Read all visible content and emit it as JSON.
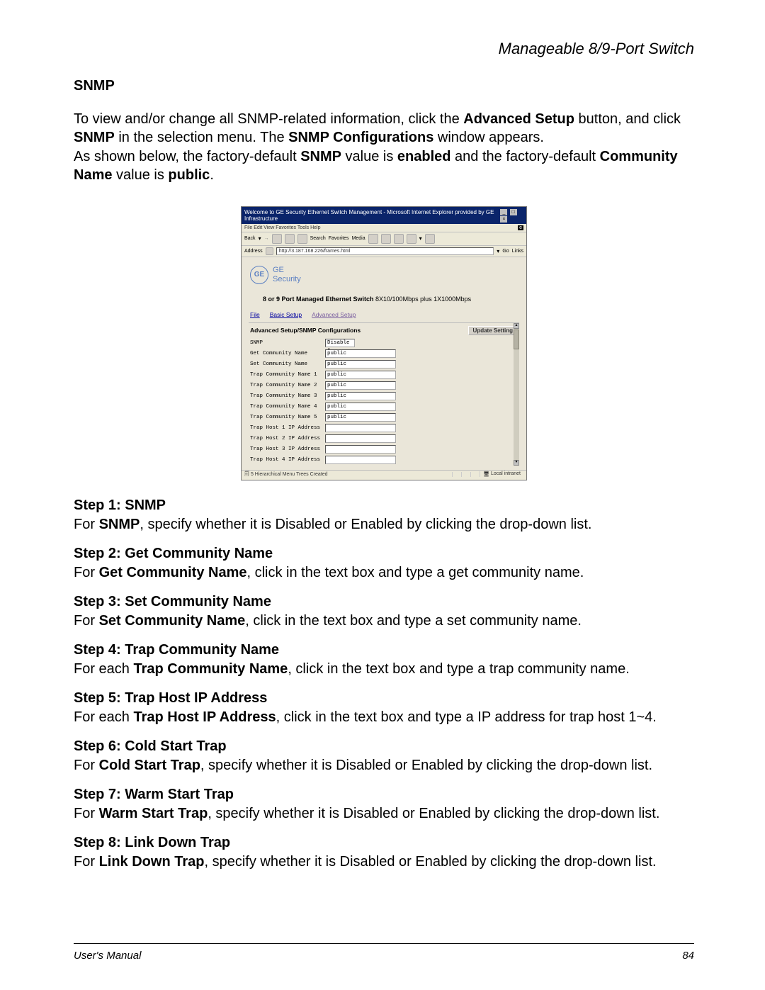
{
  "header": {
    "title": "Manageable 8/9-Port Switch"
  },
  "section": {
    "title": "SNMP"
  },
  "intro": {
    "p1_a": "To view and/or change all SNMP-related information, click the ",
    "p1_b": "Advanced Setup",
    "p1_c": " button, and click ",
    "p1_d": "SNMP",
    "p1_e": " in the selection menu. The ",
    "p1_f": "SNMP Configurations",
    "p1_g": " window appears.",
    "p2_a": "As shown below, the factory-default ",
    "p2_b": "SNMP",
    "p2_c": " value is ",
    "p2_d": "enabled",
    "p2_e": " and the factory-default ",
    "p2_f": "Community Name",
    "p2_g": " value is ",
    "p2_h": "public",
    "p2_i": "."
  },
  "screenshot": {
    "titlebar": "Welcome to GE Security Ethernet Switch Management - Microsoft Internet Explorer provided by GE Infrastructure",
    "menus": "File   Edit   View   Favorites   Tools   Help",
    "ie_logo_alt": "IE",
    "toolbar": {
      "back": "Back",
      "search": "Search",
      "favorites": "Favorites",
      "media": "Media"
    },
    "address_label": "Address",
    "url": "http://3.187.168.226/frames.html",
    "go": "Go",
    "links": "Links",
    "brand": {
      "line1": "GE",
      "line2": "Security",
      "mono": "GE"
    },
    "subhead_bold": "8 or 9 Port Managed Ethernet Switch",
    "subhead_rest": "  8X10/100Mbps plus 1X1000Mbps",
    "nav": {
      "file": "File",
      "basic": "Basic Setup",
      "advanced": "Advanced Setup"
    },
    "table_title": "Advanced Setup/SNMP Configurations",
    "update_btn": "Update Setting",
    "rows": [
      {
        "label": "SNMP",
        "value": "Disable",
        "type": "select",
        "w": "w1"
      },
      {
        "label": "Get Community Name",
        "value": "public",
        "type": "text",
        "w": "w2"
      },
      {
        "label": "Set Community Name",
        "value": "public",
        "type": "text",
        "w": "w2"
      },
      {
        "label": "Trap Community Name 1",
        "value": "public",
        "type": "text",
        "w": "w2"
      },
      {
        "label": "Trap Community Name 2",
        "value": "public",
        "type": "text",
        "w": "w2"
      },
      {
        "label": "Trap Community Name 3",
        "value": "public",
        "type": "text",
        "w": "w2"
      },
      {
        "label": "Trap Community Name 4",
        "value": "public",
        "type": "text",
        "w": "w2"
      },
      {
        "label": "Trap Community Name 5",
        "value": "public",
        "type": "text",
        "w": "w2"
      },
      {
        "label": "Trap Host 1 IP Address",
        "value": "",
        "type": "text",
        "w": "w2"
      },
      {
        "label": "Trap Host 2 IP Address",
        "value": "",
        "type": "text",
        "w": "w2"
      },
      {
        "label": "Trap Host 3 IP Address",
        "value": "",
        "type": "text",
        "w": "w2"
      },
      {
        "label": "Trap Host 4 IP Address",
        "value": "",
        "type": "text",
        "w": "w2"
      }
    ],
    "status_left": "5 Hierarchical Menu Trees Created",
    "status_right": "Local intranet"
  },
  "steps": [
    {
      "title": "Step 1: SNMP",
      "a": "For ",
      "b": "SNMP",
      "c": ", specify whether it is Disabled or Enabled by clicking the drop-down list."
    },
    {
      "title": "Step 2: Get Community Name",
      "a": "For ",
      "b": "Get Community Name",
      "c": ", click in the text box and type a get community name."
    },
    {
      "title": "Step 3: Set Community Name",
      "a": "For ",
      "b": "Set Community Name",
      "c": ", click in the text box and type a set community name."
    },
    {
      "title": "Step 4: Trap Community Name",
      "a": "For each ",
      "b": "Trap Community Name",
      "c": ", click in the text box and type a trap community name."
    },
    {
      "title": "Step 5: Trap Host IP Address",
      "a": "For each ",
      "b": "Trap Host IP Address",
      "c": ", click in the text box and type a IP address for trap host 1~4."
    },
    {
      "title": "Step 6: Cold Start Trap",
      "a": "For ",
      "b": "Cold Start Trap",
      "c": ", specify whether it is Disabled or Enabled by clicking the drop-down list."
    },
    {
      "title": "Step 7: Warm Start Trap",
      "a": "For ",
      "b": "Warm Start Trap",
      "c": ", specify whether it is Disabled or Enabled by clicking the drop-down list."
    },
    {
      "title": "Step 8: Link Down Trap",
      "a": "For ",
      "b": "Link Down Trap",
      "c": ", specify whether it is Disabled or Enabled by clicking the drop-down list."
    }
  ],
  "footer": {
    "left": "User's Manual",
    "right": "84"
  }
}
